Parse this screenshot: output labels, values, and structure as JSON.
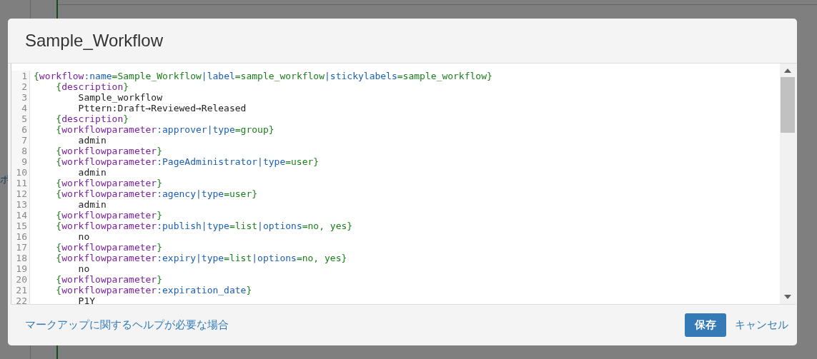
{
  "background_page": {
    "side_text": "ポ"
  },
  "dialog": {
    "title": "Sample_Workflow",
    "editor": {
      "lines": [
        {
          "number": "1",
          "tokens": [
            {
              "kind": "value",
              "text": "{"
            },
            {
              "kind": "tag",
              "text": "workflow"
            },
            {
              "kind": "key",
              "text": ":name"
            },
            {
              "kind": "value",
              "text": "=Sample_Workflow"
            },
            {
              "kind": "key",
              "text": "|label"
            },
            {
              "kind": "value",
              "text": "=sample_workflow"
            },
            {
              "kind": "key",
              "text": "|stickylabels"
            },
            {
              "kind": "value",
              "text": "=sample_workflow}"
            }
          ]
        },
        {
          "number": "2",
          "tokens": [
            {
              "kind": "value",
              "text": "    {"
            },
            {
              "kind": "tag",
              "text": "description"
            },
            {
              "kind": "value",
              "text": "}"
            }
          ]
        },
        {
          "number": "3",
          "tokens": [
            {
              "kind": "plain",
              "text": "        Sample_workflow"
            }
          ]
        },
        {
          "number": "4",
          "tokens": [
            {
              "kind": "plain",
              "text": "        Pttern:Draft→Reviewed→Released"
            }
          ]
        },
        {
          "number": "5",
          "tokens": [
            {
              "kind": "value",
              "text": "    {"
            },
            {
              "kind": "tag",
              "text": "description"
            },
            {
              "kind": "value",
              "text": "}"
            }
          ]
        },
        {
          "number": "6",
          "tokens": [
            {
              "kind": "value",
              "text": "    {"
            },
            {
              "kind": "tag",
              "text": "workflowparameter"
            },
            {
              "kind": "key",
              "text": ":approver|type"
            },
            {
              "kind": "value",
              "text": "=group}"
            }
          ]
        },
        {
          "number": "7",
          "tokens": [
            {
              "kind": "plain",
              "text": "        admin"
            }
          ]
        },
        {
          "number": "8",
          "tokens": [
            {
              "kind": "value",
              "text": "    {"
            },
            {
              "kind": "tag",
              "text": "workflowparameter"
            },
            {
              "kind": "value",
              "text": "}"
            }
          ]
        },
        {
          "number": "9",
          "tokens": [
            {
              "kind": "value",
              "text": "    {"
            },
            {
              "kind": "tag",
              "text": "workflowparameter"
            },
            {
              "kind": "key",
              "text": ":PageAdministrator|type"
            },
            {
              "kind": "value",
              "text": "=user}"
            }
          ]
        },
        {
          "number": "10",
          "tokens": [
            {
              "kind": "plain",
              "text": "        admin"
            }
          ]
        },
        {
          "number": "11",
          "tokens": [
            {
              "kind": "value",
              "text": "    {"
            },
            {
              "kind": "tag",
              "text": "workflowparameter"
            },
            {
              "kind": "value",
              "text": "}"
            }
          ]
        },
        {
          "number": "12",
          "tokens": [
            {
              "kind": "value",
              "text": "    {"
            },
            {
              "kind": "tag",
              "text": "workflowparameter"
            },
            {
              "kind": "key",
              "text": ":agency|type"
            },
            {
              "kind": "value",
              "text": "=user}"
            }
          ]
        },
        {
          "number": "13",
          "tokens": [
            {
              "kind": "plain",
              "text": "        admin"
            }
          ]
        },
        {
          "number": "14",
          "tokens": [
            {
              "kind": "value",
              "text": "    {"
            },
            {
              "kind": "tag",
              "text": "workflowparameter"
            },
            {
              "kind": "value",
              "text": "}"
            }
          ]
        },
        {
          "number": "15",
          "tokens": [
            {
              "kind": "value",
              "text": "    {"
            },
            {
              "kind": "tag",
              "text": "workflowparameter"
            },
            {
              "kind": "key",
              "text": ":publish|type"
            },
            {
              "kind": "value",
              "text": "=list"
            },
            {
              "kind": "key",
              "text": "|options"
            },
            {
              "kind": "value",
              "text": "=no, yes}"
            }
          ]
        },
        {
          "number": "16",
          "tokens": [
            {
              "kind": "plain",
              "text": "        no"
            }
          ]
        },
        {
          "number": "17",
          "tokens": [
            {
              "kind": "value",
              "text": "    {"
            },
            {
              "kind": "tag",
              "text": "workflowparameter"
            },
            {
              "kind": "value",
              "text": "}"
            }
          ]
        },
        {
          "number": "18",
          "tokens": [
            {
              "kind": "value",
              "text": "    {"
            },
            {
              "kind": "tag",
              "text": "workflowparameter"
            },
            {
              "kind": "key",
              "text": ":expiry|type"
            },
            {
              "kind": "value",
              "text": "=list"
            },
            {
              "kind": "key",
              "text": "|options"
            },
            {
              "kind": "value",
              "text": "=no, yes}"
            }
          ]
        },
        {
          "number": "19",
          "tokens": [
            {
              "kind": "plain",
              "text": "        no"
            }
          ]
        },
        {
          "number": "20",
          "tokens": [
            {
              "kind": "value",
              "text": "    {"
            },
            {
              "kind": "tag",
              "text": "workflowparameter"
            },
            {
              "kind": "value",
              "text": "}"
            }
          ]
        },
        {
          "number": "21",
          "tokens": [
            {
              "kind": "value",
              "text": "    {"
            },
            {
              "kind": "tag",
              "text": "workflowparameter"
            },
            {
              "kind": "key",
              "text": ":expiration_date"
            },
            {
              "kind": "value",
              "text": "}"
            }
          ]
        },
        {
          "number": "22",
          "tokens": [
            {
              "kind": "plain",
              "text": "        P1Y"
            }
          ]
        }
      ]
    },
    "footer": {
      "help_link": "マークアップに関するヘルプが必要な場合",
      "save_button": "保存",
      "cancel_link": "キャンセル"
    }
  }
}
